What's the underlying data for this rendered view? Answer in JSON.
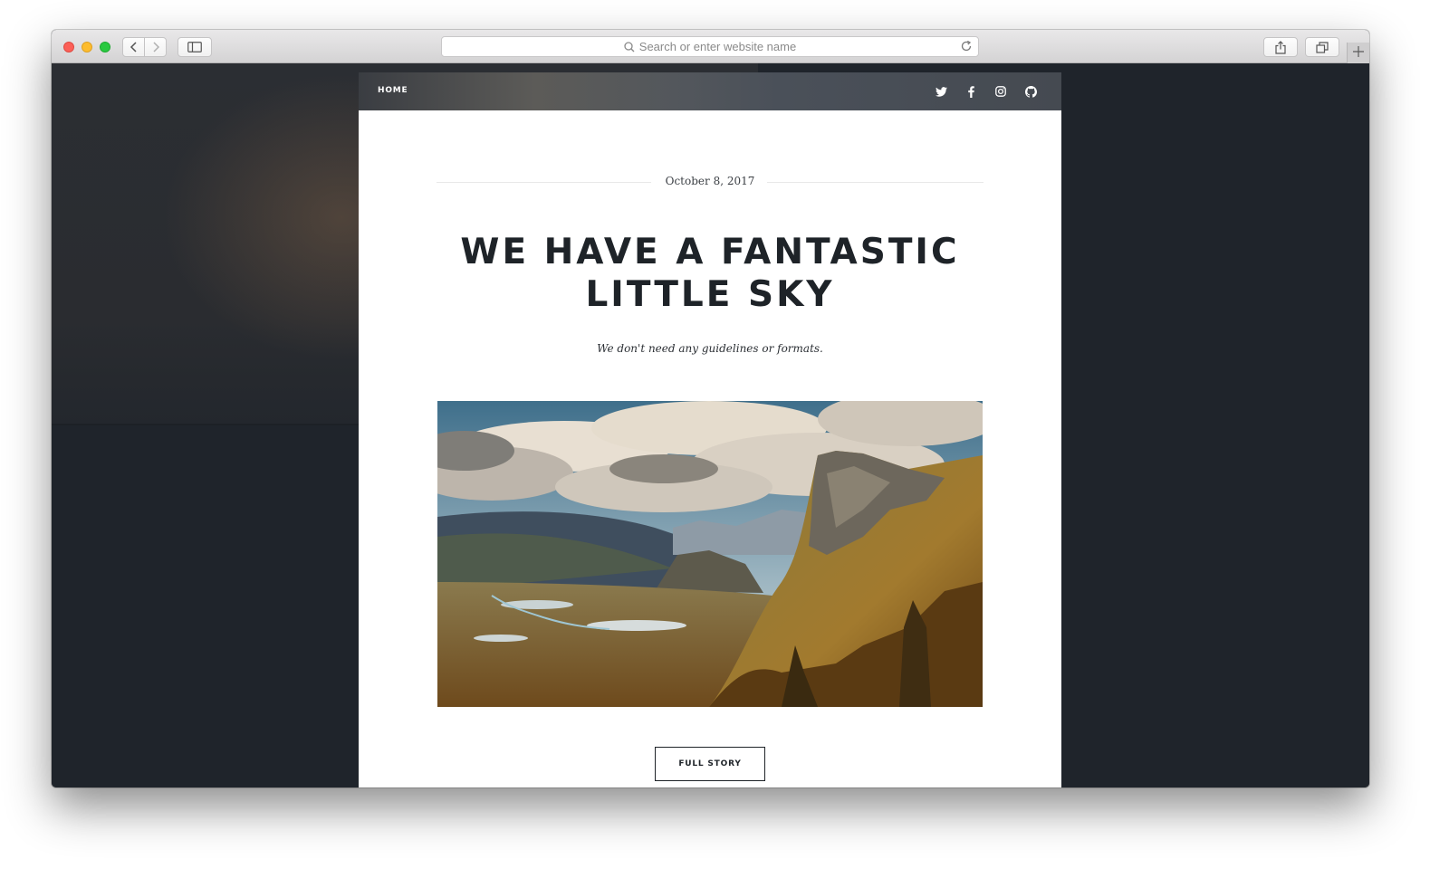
{
  "browser": {
    "url_placeholder": "Search or enter website name",
    "icons": [
      "back-icon",
      "forward-icon",
      "sidebar-icon",
      "search-icon",
      "reload-icon",
      "share-icon",
      "tabs-icon",
      "new-tab-icon"
    ]
  },
  "site": {
    "nav": {
      "home_label": "HOME",
      "social": [
        "twitter-icon",
        "facebook-icon",
        "instagram-icon",
        "github-icon"
      ]
    }
  },
  "post": {
    "date": "October 8, 2017",
    "title_line1": "WE HAVE A FANTASTIC",
    "title_line2": "LITTLE SKY",
    "subtitle": "We don't need any guidelines or formats.",
    "cta_label": "FULL STORY"
  },
  "colors": {
    "page_bg": "#1f242b",
    "text_dark": "#1e2328",
    "nav_bg": "#4a4e54"
  }
}
